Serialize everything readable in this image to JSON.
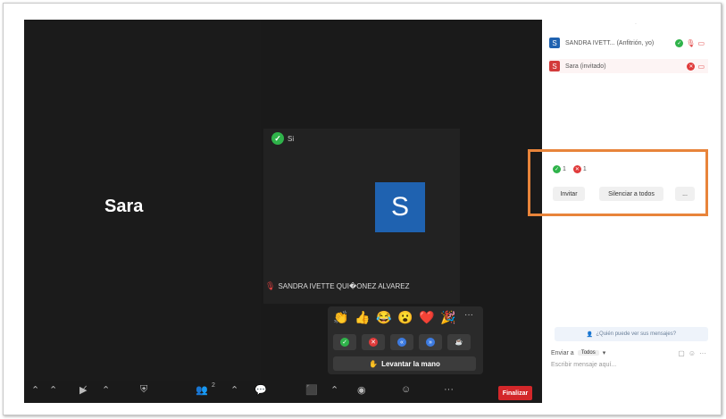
{
  "meeting": {
    "sara_tile_name": "Sara",
    "sandra_avatar_letter": "S",
    "top_status_text": "Si",
    "sandra_name_tag": "SANDRA IVETTE QUI�ONEZ ALVAREZ"
  },
  "reactions": {
    "emojis": [
      "👏",
      "👍",
      "😂",
      "😮",
      "❤️",
      "🎉"
    ],
    "more": "···",
    "raise_hand_label": "Levantar la mano"
  },
  "toolbar": {
    "participant_count": "2",
    "end_label": "Finalizar"
  },
  "participants": {
    "items": [
      {
        "letter": "S",
        "name": "SANDRA IVETT... (Anfitrión, yo)",
        "color": "#1f62b0"
      },
      {
        "letter": "S",
        "name": "Sara (invitado)",
        "color": "#d33b3b"
      }
    ],
    "yes_count": "1",
    "no_count": "1",
    "invite_label": "Invitar",
    "mute_all_label": "Silenciar a todos",
    "more_label": "..."
  },
  "chat": {
    "hint": "¿Quién puede ver sus mensajes?",
    "send_to_label": "Enviar a",
    "send_to_value": "Todos",
    "input_placeholder": "Escribir mensaje aquí..."
  },
  "colors": {
    "highlight": "#e8843a",
    "end_button": "#d3272a",
    "avatar_blue": "#1f62b0"
  }
}
